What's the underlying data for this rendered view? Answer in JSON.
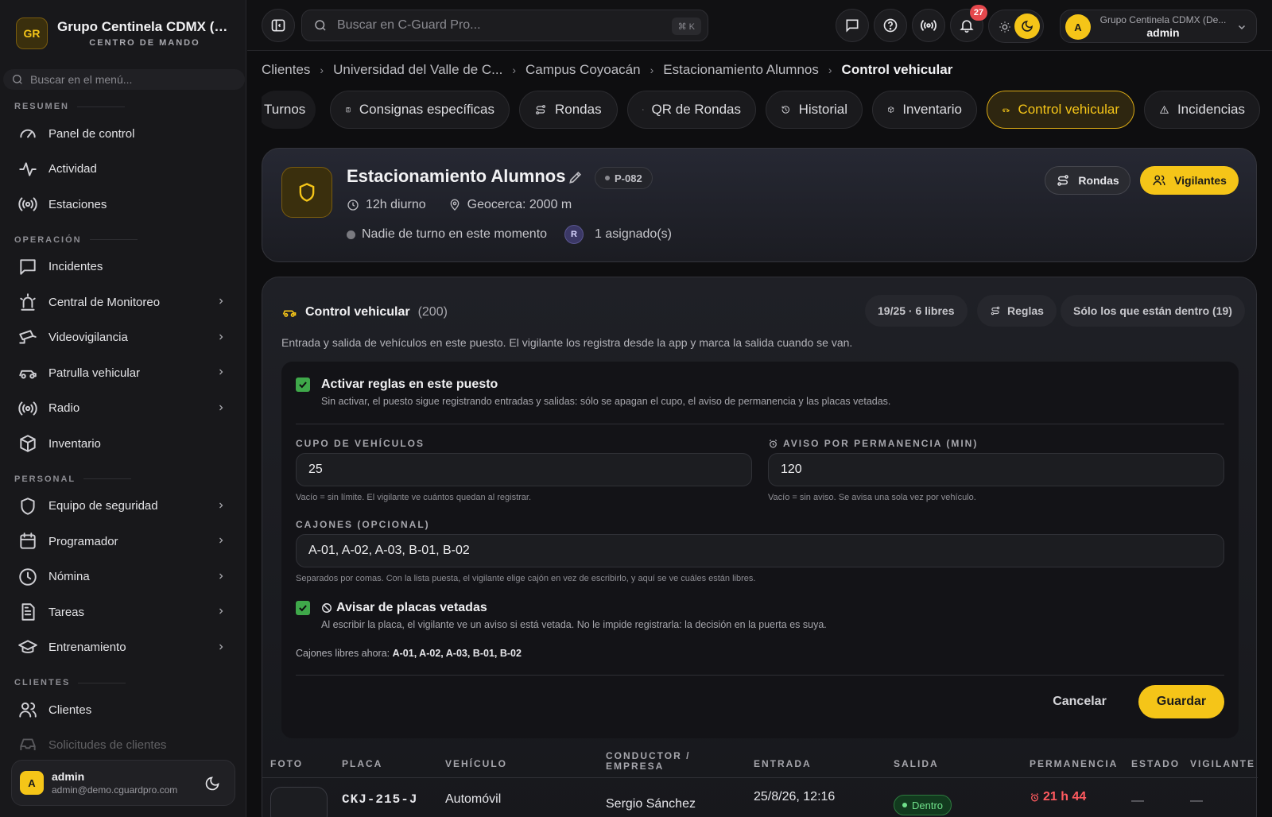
{
  "colors": {
    "accent": "#f5c518",
    "success": "#3fa84a",
    "danger": "#e5484d"
  },
  "sidebar": {
    "brand_initials": "GR",
    "brand_name": "Grupo Centinela CDMX (De...",
    "brand_sub": "CENTRO DE MANDO",
    "search_placeholder": "Buscar en el menú...",
    "sections": [
      {
        "title": "RESUMEN",
        "items": [
          {
            "label": "Panel de control",
            "icon": "gauge-icon"
          },
          {
            "label": "Actividad",
            "icon": "activity-icon"
          },
          {
            "label": "Estaciones",
            "icon": "broadcast-icon"
          }
        ]
      },
      {
        "title": "OPERACIÓN",
        "items": [
          {
            "label": "Incidentes",
            "icon": "message-square-icon"
          },
          {
            "label": "Central de Monitoreo",
            "icon": "siren-icon"
          },
          {
            "label": "Videovigilancia",
            "icon": "cctv-icon"
          },
          {
            "label": "Patrulla vehicular",
            "icon": "car-icon"
          },
          {
            "label": "Radio",
            "icon": "radio-icon"
          },
          {
            "label": "Inventario",
            "icon": "package-icon"
          }
        ]
      },
      {
        "title": "PERSONAL",
        "items": [
          {
            "label": "Equipo de seguridad",
            "icon": "shield-icon"
          },
          {
            "label": "Programador",
            "icon": "calendar-icon"
          },
          {
            "label": "Nómina",
            "icon": "clock-icon"
          },
          {
            "label": "Tareas",
            "icon": "file-text-icon"
          },
          {
            "label": "Entrenamiento",
            "icon": "graduation-cap-icon"
          }
        ]
      },
      {
        "title": "CLIENTES",
        "items": [
          {
            "label": "Clientes",
            "icon": "users-icon"
          },
          {
            "label": "Solicitudes de clientes",
            "icon": "inbox-icon"
          }
        ]
      }
    ],
    "user": {
      "initial": "A",
      "name": "admin",
      "email": "admin@demo.cguardpro.com"
    }
  },
  "topbar": {
    "search_placeholder": "Buscar en C-Guard Pro...",
    "search_shortcut": "⌘ K",
    "notifications_count": "27",
    "account": {
      "initial": "A",
      "org": "Grupo Centinela CDMX (De...",
      "name": "admin"
    }
  },
  "breadcrumb": [
    "Clientes",
    "Universidad del Valle de C...",
    "Campus Coyoacán",
    "Estacionamiento Alumnos",
    "Control vehicular"
  ],
  "tabs": [
    {
      "label": "Turnos",
      "icon": ""
    },
    {
      "label": "Consignas específicas",
      "icon": "clipboard-icon"
    },
    {
      "label": "Rondas",
      "icon": "route-icon"
    },
    {
      "label": "QR de Rondas",
      "icon": "qr-code-icon"
    },
    {
      "label": "Historial",
      "icon": "history-icon"
    },
    {
      "label": "Inventario",
      "icon": "package-icon"
    },
    {
      "label": "Control vehicular",
      "icon": "car-icon",
      "active": true
    },
    {
      "label": "Incidencias",
      "icon": "alert-triangle-icon"
    }
  ],
  "post": {
    "name": "Estacionamiento Alumnos",
    "code": "P-082",
    "shift": "12h diurno",
    "geofence": "Geocerca: 2000 m",
    "status": "Nadie de turno en este momento",
    "assigned_initial": "R",
    "assigned": "1 asignado(s)",
    "rondas_button": "Rondas",
    "vigilantes_button": "Vigilantes"
  },
  "vehicle_control": {
    "title": "Control vehicular",
    "count": "(200)",
    "capacity_chip": "19/25 · 6 libres",
    "rules_chip": "Reglas",
    "filter_chip": "Sólo los que están dentro (19)",
    "description": "Entrada y salida de vehículos en este puesto. El vigilante los registra desde la app y marca la salida cuando se van.",
    "rules": {
      "activate_label": "Activar reglas en este puesto",
      "activate_help": "Sin activar, el puesto sigue registrando entradas y salidas: sólo se apagan el cupo, el aviso de permanencia y las placas vetadas.",
      "activate_checked": true,
      "capacity_label": "CUPO DE VEHÍCULOS",
      "capacity_value": "25",
      "capacity_help": "Vacío = sin límite. El vigilante ve cuántos quedan al registrar.",
      "stay_label": "AVISO POR PERMANENCIA (MIN)",
      "stay_value": "120",
      "stay_help": "Vacío = sin aviso. Se avisa una sola vez por vehículo.",
      "slots_label": "CAJONES (OPCIONAL)",
      "slots_value": "A-01, A-02, A-03, B-01, B-02",
      "slots_help": "Separados por comas. Con la lista puesta, el vigilante elige cajón en vez de escribirlo, y aquí se ve cuáles están libres.",
      "vetted_label": "Avisar de placas vetadas",
      "vetted_help": "Al escribir la placa, el vigilante ve un aviso si está vetada. No le impide registrarla: la decisión en la puerta es suya.",
      "vetted_checked": true,
      "free_prefix": "Cajones libres ahora: ",
      "free_slots": "A-01, A-02, A-03, B-01, B-02",
      "cancel": "Cancelar",
      "save": "Guardar"
    },
    "table": {
      "headers": [
        "FOTO",
        "PLACA",
        "VEHÍCULO",
        "CONDUCTOR /",
        "EMPRESA",
        "ENTRADA",
        "SALIDA",
        "PERMANENCIA",
        "ESTADO",
        "VIGILANTE"
      ],
      "rows": [
        {
          "plate": "CKJ-215-J",
          "vehicle": "Automóvil",
          "driver": "Sergio Sánchez",
          "entry": "25/8/26, 12:16",
          "status": "Dentro",
          "stay": "21 h 44",
          "estado": "—",
          "guard": "—"
        }
      ]
    }
  }
}
